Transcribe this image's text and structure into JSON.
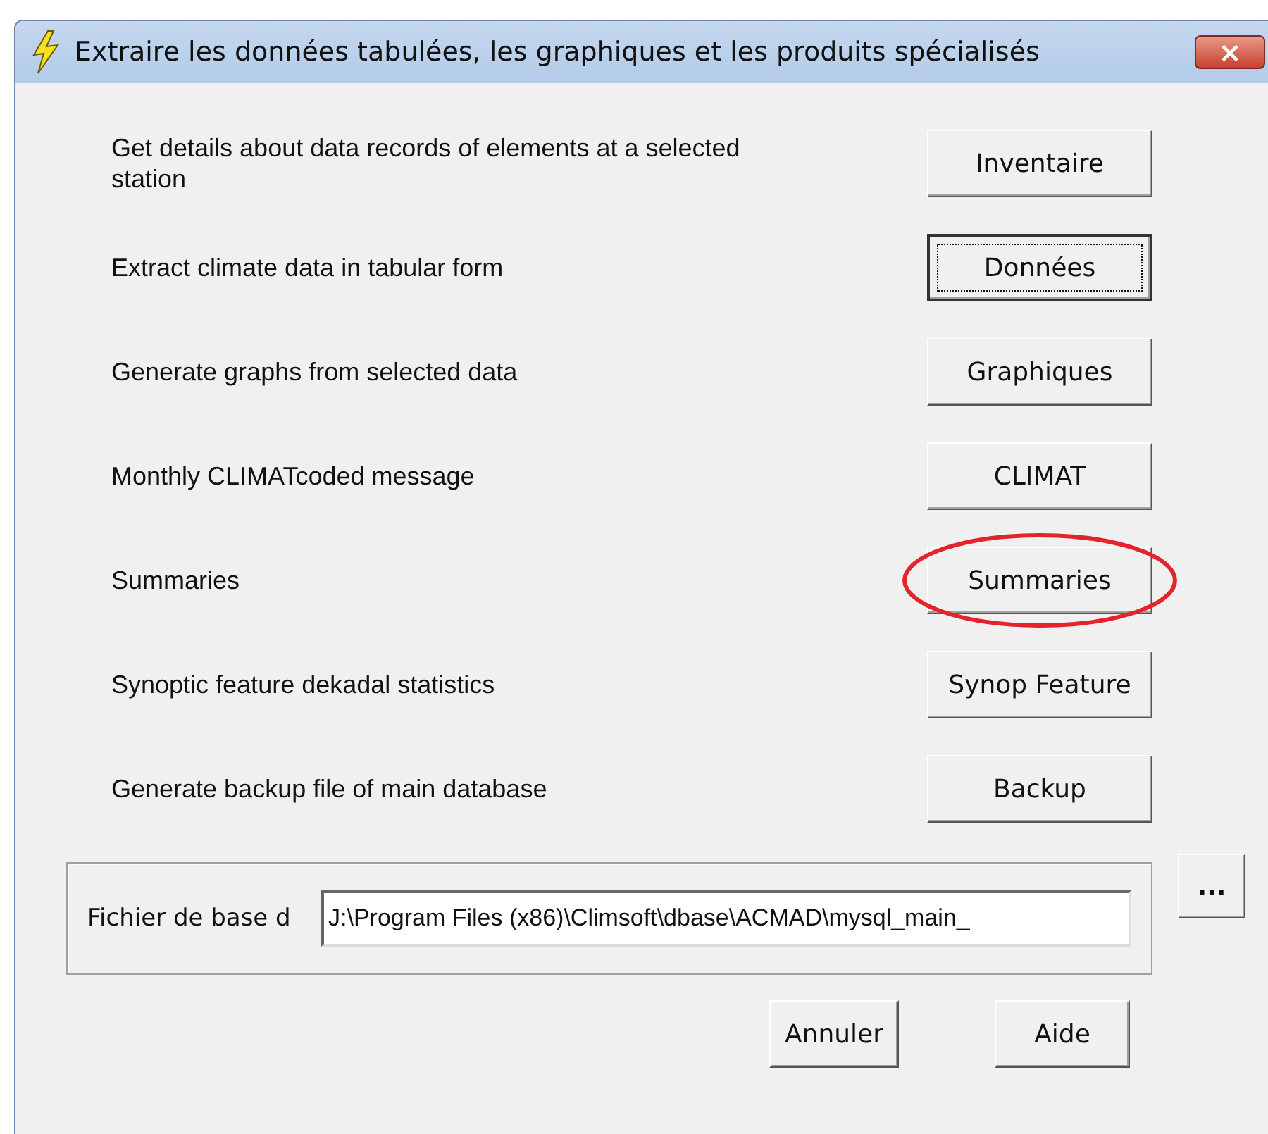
{
  "window": {
    "title": "Extraire les données tabulées, les graphiques et les produits spécialisés",
    "close": "×"
  },
  "actions": [
    {
      "description": "Get details about data records of elements at a selected station",
      "button": "Inventaire",
      "focused": false,
      "circled": false
    },
    {
      "description": "Extract climate data in tabular form",
      "button": "Données",
      "focused": true,
      "circled": false
    },
    {
      "description": "Generate graphs from selected data",
      "button": "Graphiques",
      "focused": false,
      "circled": false
    },
    {
      "description": "Monthly CLIMATcoded message",
      "button": "CLIMAT",
      "focused": false,
      "circled": false
    },
    {
      "description": "Summaries",
      "button": "Summaries",
      "focused": false,
      "circled": true
    },
    {
      "description": "Synoptic feature dekadal statistics",
      "button": "Synop Feature",
      "focused": false,
      "circled": false
    },
    {
      "description": "Generate backup file of main database",
      "button": "Backup",
      "focused": false,
      "circled": false
    }
  ],
  "database_file": {
    "label": "Fichier de base d",
    "value": "J:\\Program Files (x86)\\Climsoft\\dbase\\ACMAD\\mysql_main_",
    "browse": "..."
  },
  "buttons": [
    "Annuler",
    "Aide"
  ]
}
